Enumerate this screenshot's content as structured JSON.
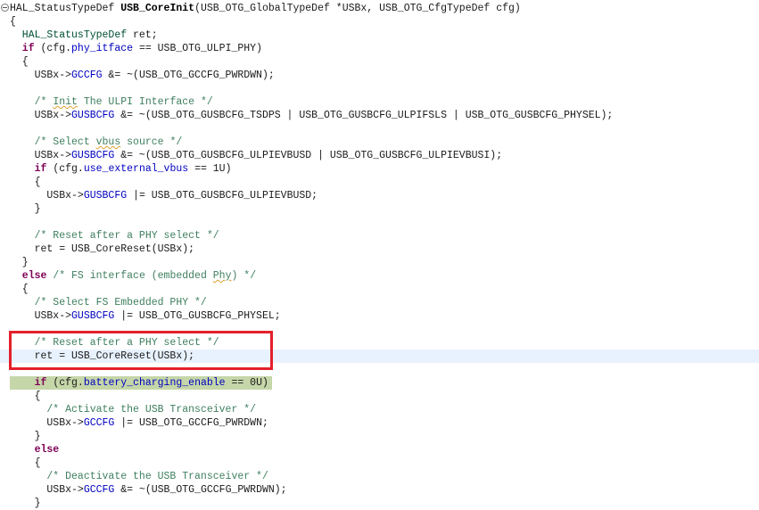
{
  "editor": {
    "current_line": 26,
    "matched_line": 28,
    "annotation_color": "#e3202b",
    "lines": [
      [
        [
          "n",
          "HAL_StatusTypeDef "
        ],
        [
          "b",
          "USB_CoreInit"
        ],
        [
          "n",
          "(USB_OTG_GlobalTypeDef *USBx, USB_OTG_CfgTypeDef cfg)"
        ]
      ],
      [
        [
          "n",
          "{"
        ]
      ],
      [
        [
          "t",
          "  HAL_StatusTypeDef"
        ],
        [
          "n",
          " ret;"
        ]
      ],
      [
        [
          "k",
          "  if"
        ],
        [
          "n",
          " (cfg."
        ],
        [
          "f",
          "phy_itface"
        ],
        [
          "n",
          " == USB_OTG_ULPI_PHY)"
        ]
      ],
      [
        [
          "n",
          "  {"
        ]
      ],
      [
        [
          "n",
          "    USBx->"
        ],
        [
          "f",
          "GCCFG"
        ],
        [
          "n",
          " &= ~(USB_OTG_GCCFG_PWRDWN);"
        ]
      ],
      [],
      [
        [
          "c",
          "    /* "
        ],
        [
          "c sp",
          "Init"
        ],
        [
          "c",
          " The ULPI Interface */"
        ]
      ],
      [
        [
          "n",
          "    USBx->"
        ],
        [
          "f",
          "GUSBCFG"
        ],
        [
          "n",
          " &= ~(USB_OTG_GUSBCFG_TSDPS | USB_OTG_GUSBCFG_ULPIFSLS | USB_OTG_GUSBCFG_PHYSEL);"
        ]
      ],
      [],
      [
        [
          "c",
          "    /* Select "
        ],
        [
          "c sp",
          "vbus"
        ],
        [
          "c",
          " source */"
        ]
      ],
      [
        [
          "n",
          "    USBx->"
        ],
        [
          "f",
          "GUSBCFG"
        ],
        [
          "n",
          " &= ~(USB_OTG_GUSBCFG_ULPIEVBUSD | USB_OTG_GUSBCFG_ULPIEVBUSI);"
        ]
      ],
      [
        [
          "k",
          "    if"
        ],
        [
          "n",
          " (cfg."
        ],
        [
          "f",
          "use_external_vbus"
        ],
        [
          "n",
          " == 1U)"
        ]
      ],
      [
        [
          "n",
          "    {"
        ]
      ],
      [
        [
          "n",
          "      USBx->"
        ],
        [
          "f",
          "GUSBCFG"
        ],
        [
          "n",
          " |= USB_OTG_GUSBCFG_ULPIEVBUSD;"
        ]
      ],
      [
        [
          "n",
          "    }"
        ]
      ],
      [],
      [
        [
          "c",
          "    /* Reset after a PHY select */"
        ]
      ],
      [
        [
          "n",
          "    ret = USB_CoreReset(USBx);"
        ]
      ],
      [
        [
          "n",
          "  }"
        ]
      ],
      [
        [
          "k",
          "  else"
        ],
        [
          "c",
          " /* FS interface (embedded "
        ],
        [
          "c sp",
          "Phy"
        ],
        [
          "c",
          ") */"
        ]
      ],
      [
        [
          "n",
          "  {"
        ]
      ],
      [
        [
          "c",
          "    /* Select FS Embedded PHY */"
        ]
      ],
      [
        [
          "n",
          "    USBx->"
        ],
        [
          "f",
          "GUSBCFG"
        ],
        [
          "n",
          " |= USB_OTG_GUSBCFG_PHYSEL;"
        ]
      ],
      [],
      [
        [
          "c",
          "    /* Reset after a PHY select */"
        ]
      ],
      [
        [
          "n",
          "    ret = USB_CoreReset(USBx);"
        ]
      ],
      [],
      [
        [
          "k",
          "    if"
        ],
        [
          "n",
          " (cfg."
        ],
        [
          "f",
          "battery_charging_enable"
        ],
        [
          "n",
          " == 0U)"
        ]
      ],
      [
        [
          "n",
          "    {"
        ]
      ],
      [
        [
          "c",
          "      /* Activate the USB Transceiver */"
        ]
      ],
      [
        [
          "n",
          "      USBx->"
        ],
        [
          "f",
          "GCCFG"
        ],
        [
          "n",
          " |= USB_OTG_GCCFG_PWRDWN;"
        ]
      ],
      [
        [
          "n",
          "    }"
        ]
      ],
      [
        [
          "k",
          "    else"
        ]
      ],
      [
        [
          "n",
          "    {"
        ]
      ],
      [
        [
          "c",
          "      /* Deactivate the USB Transceiver */"
        ]
      ],
      [
        [
          "n",
          "      USBx->"
        ],
        [
          "f",
          "GCCFG"
        ],
        [
          "n",
          " &= ~(USB_OTG_GCCFG_PWRDWN);"
        ]
      ],
      [
        [
          "n",
          "    }"
        ]
      ]
    ]
  }
}
